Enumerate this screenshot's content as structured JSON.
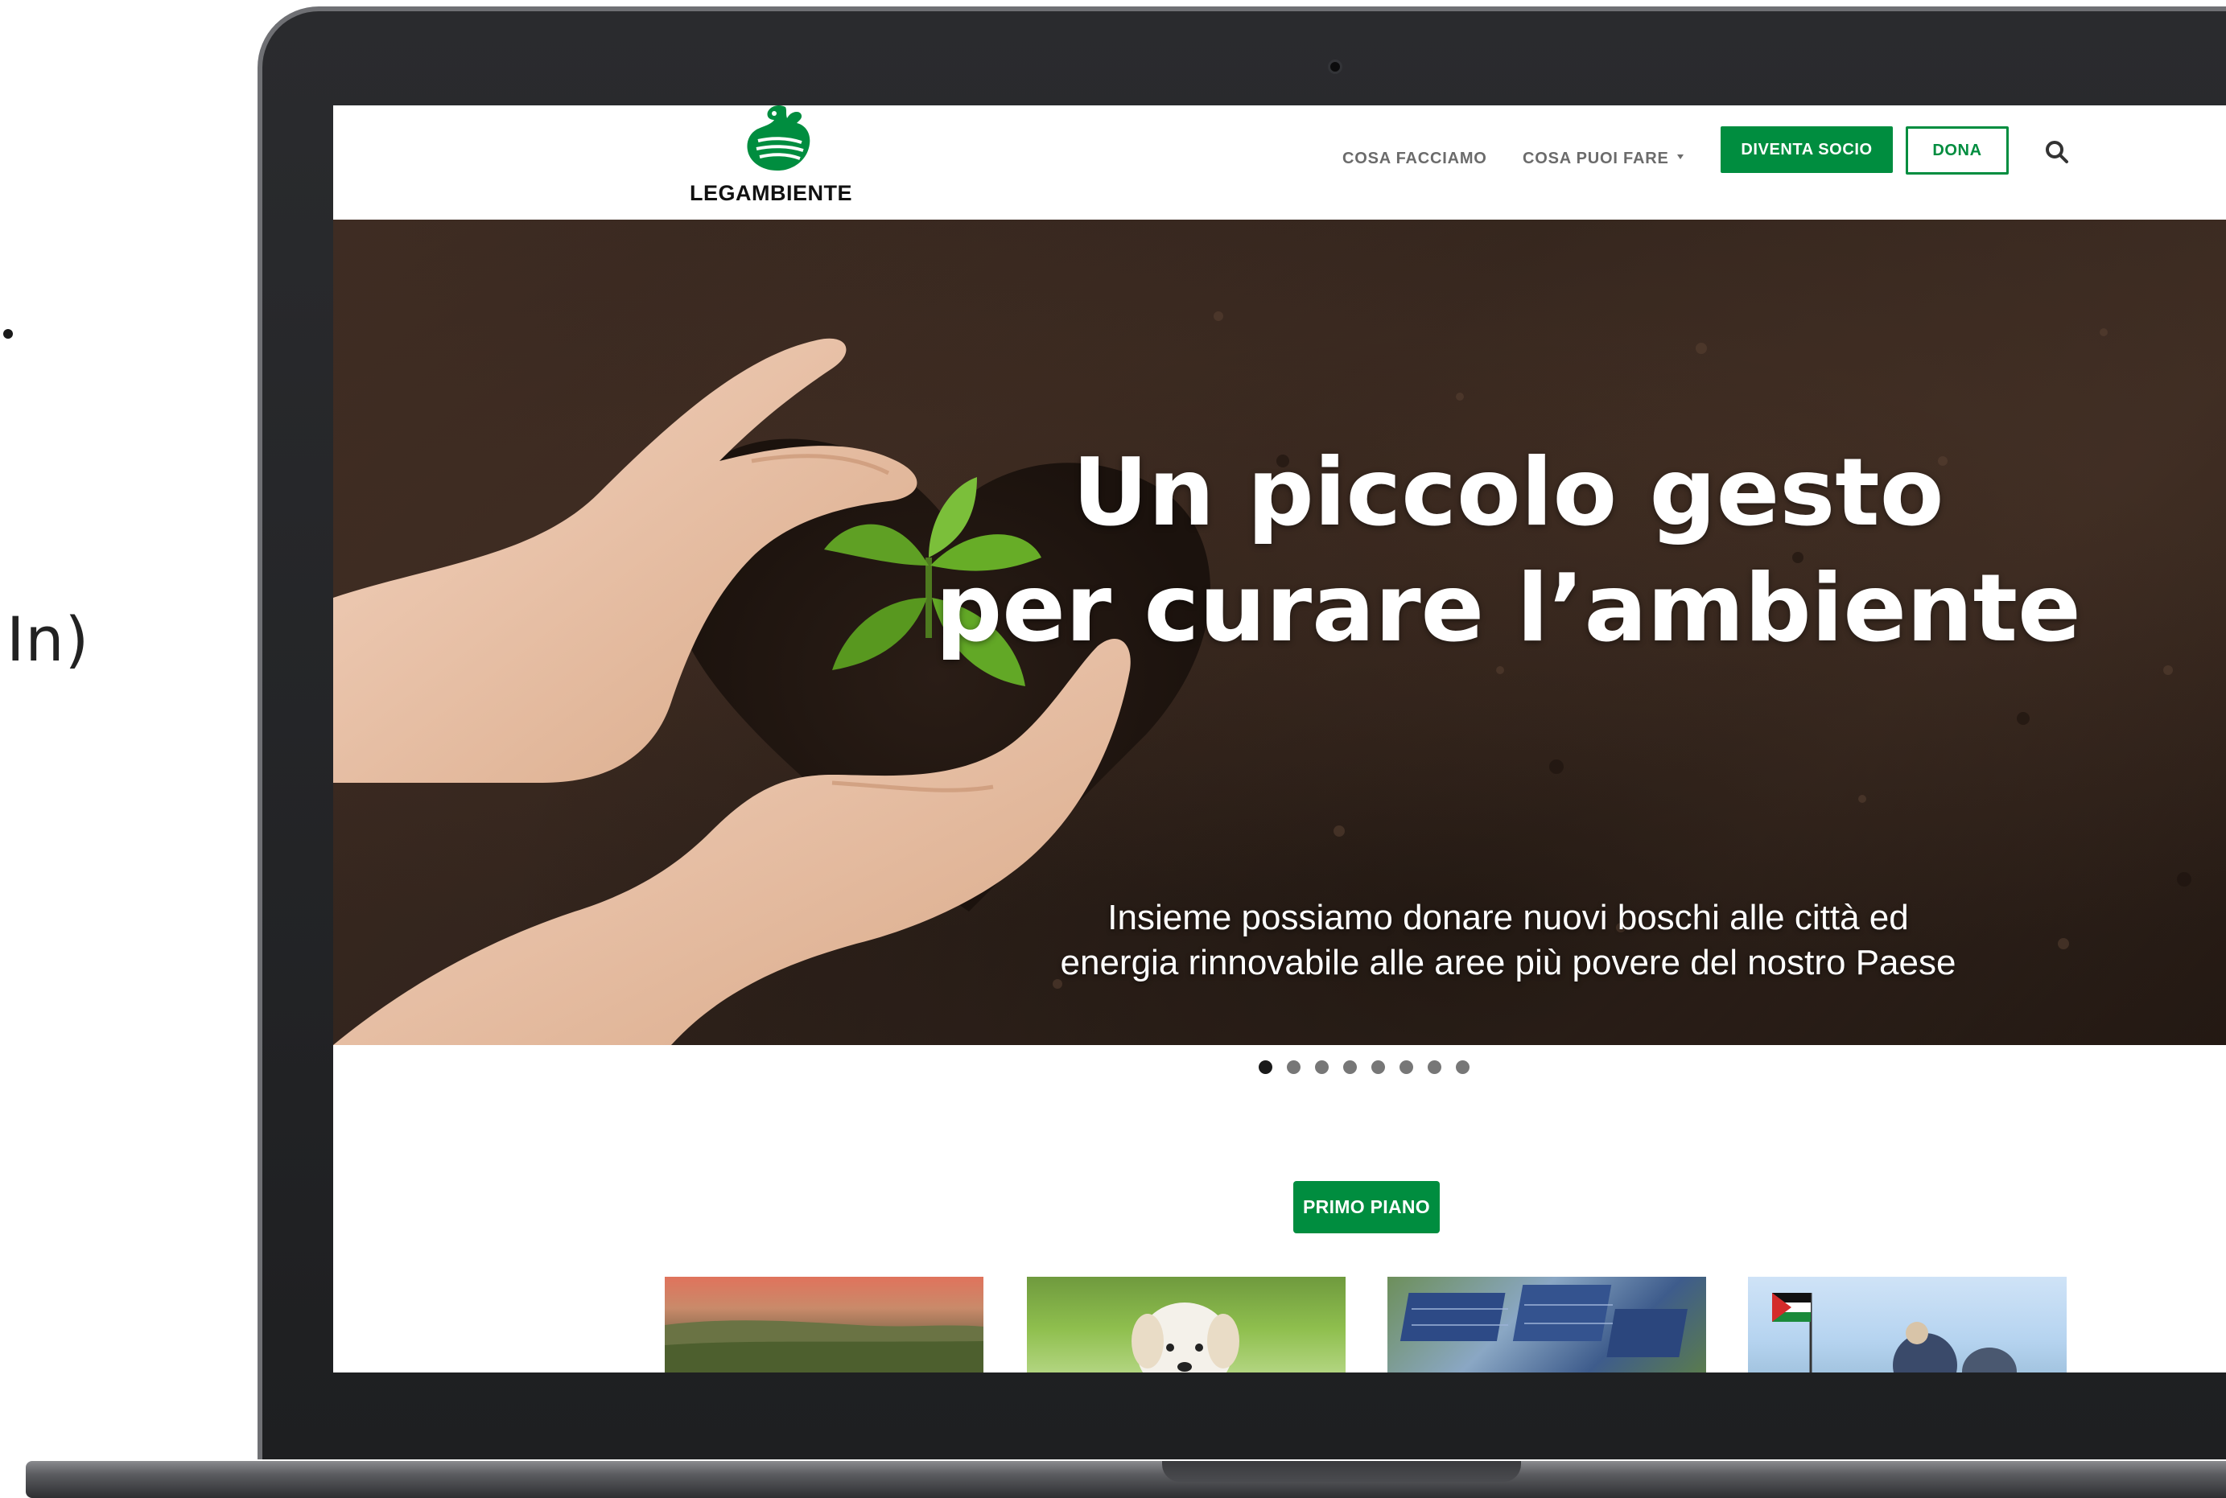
{
  "left_fragment": {
    "text": "In)"
  },
  "header": {
    "logo_text": "LEGAMBIENTE",
    "nav": [
      {
        "label": "COSA FACCIAMO"
      },
      {
        "label": "COSA PUOI FARE"
      }
    ],
    "cta_socio": "DIVENTA SOCIO",
    "cta_dona": "DONA",
    "search_icon": "search-icon"
  },
  "hero": {
    "title_line1": "Un piccolo gesto",
    "title_line2": "per curare l’ambiente",
    "subtitle_line1": "Insieme possiamo donare nuovi boschi alle città ed",
    "subtitle_line2": "energia rinnovabile alle aree più povere del nostro Paese"
  },
  "slider": {
    "total": 8,
    "active": 1
  },
  "section": {
    "primo_piano": "PRIMO PIANO"
  },
  "colors": {
    "brand_green": "#008d3f",
    "soil": "#3a2a21",
    "nav_gray": "#6b6b6b"
  }
}
